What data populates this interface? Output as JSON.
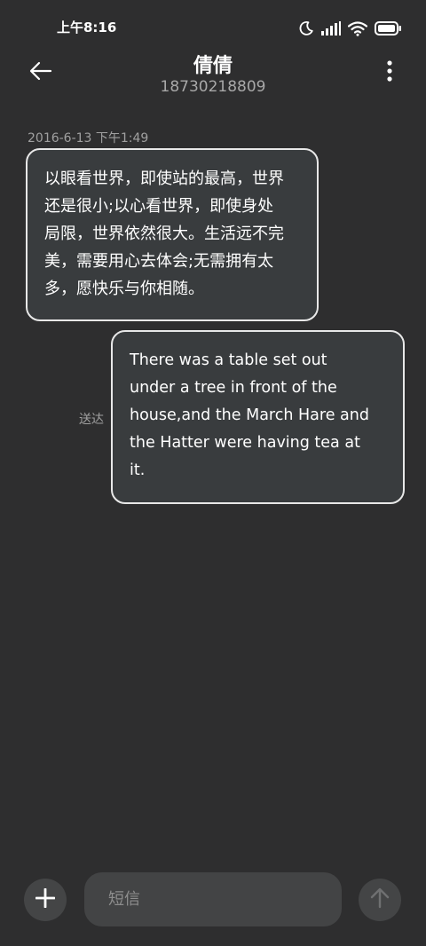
{
  "status_bar": {
    "time": "上午8:16",
    "icons": [
      "moon-icon",
      "signal-icon",
      "wifi-icon",
      "battery-icon"
    ]
  },
  "header": {
    "contact_name": "倩倩",
    "contact_number": "18730218809",
    "back_icon": "back-arrow-icon",
    "more_icon": "more-vertical-icon"
  },
  "conversation": {
    "timestamp": "2016-6-13 下午1:49",
    "incoming": {
      "lines": [
        "以眼看世界，即使站的最高，世界",
        "还是很小;以心看世界，即使身处",
        "局限，世界依然很大。生活远不完",
        "美，需要用心去体会;无需拥有太",
        "多，愿快乐与你相随。"
      ]
    },
    "outgoing": {
      "lines": [
        "There was a table set out",
        "under a tree in front of the",
        "house,and the March Hare and",
        "the Hatter were having tea at",
        "it."
      ],
      "status": "送达"
    }
  },
  "composer": {
    "placeholder": "短信",
    "value": "",
    "add_icon": "plus-icon",
    "send_icon": "send-arrow-icon"
  },
  "colors": {
    "background": "#2e2e2f",
    "bubble_background": "#393c3e",
    "bubble_border": "#e8e8e8",
    "secondary_text": "#a0a0a0",
    "control_background": "#444546"
  }
}
